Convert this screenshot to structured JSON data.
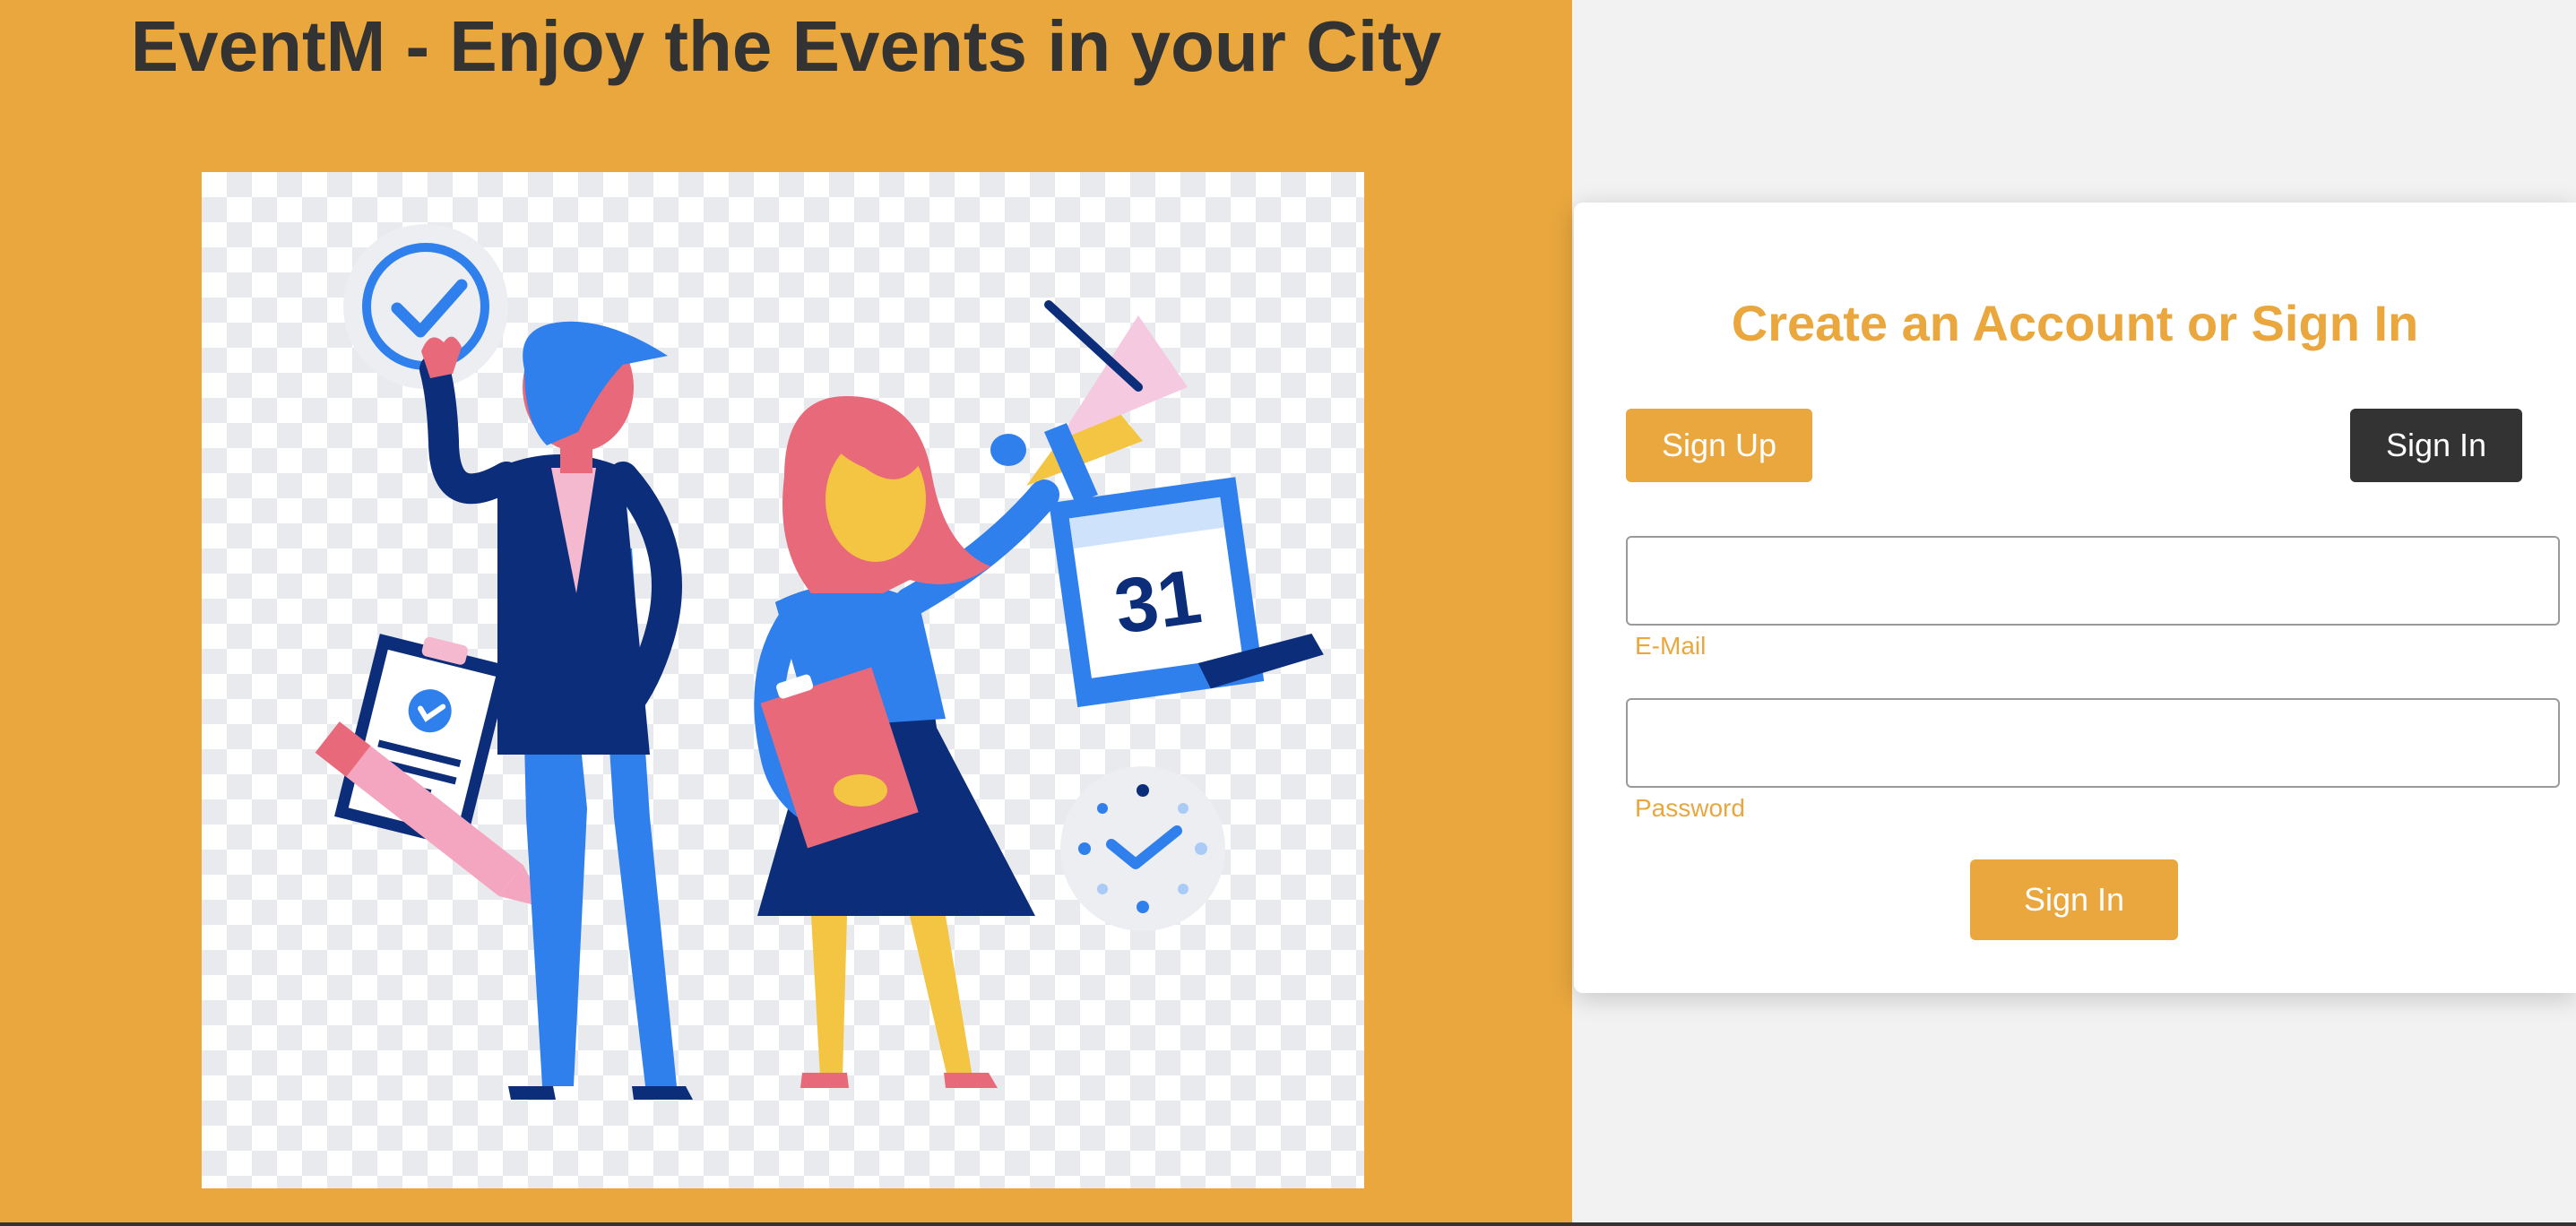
{
  "hero": {
    "title": "EventM - Enjoy the Events in your City",
    "illustration": {
      "description_icon_names": [
        "checkmark-badge-icon",
        "clipboard-icon",
        "pencil-icon",
        "megaphone-icon",
        "calendar-icon",
        "clock-icon"
      ],
      "calendar_day": "31"
    }
  },
  "auth": {
    "title": "Create an Account or Sign In",
    "signup_tab_label": "Sign Up",
    "signin_tab_label": "Sign In",
    "email": {
      "label": "E-Mail",
      "value": "",
      "placeholder": ""
    },
    "password": {
      "label": "Password",
      "value": "",
      "placeholder": ""
    },
    "submit_label": "Sign In"
  },
  "colors": {
    "accent": "#e9a73e",
    "dark": "#333333",
    "page_background": "#f2f2f2",
    "card_background": "#ffffff"
  }
}
